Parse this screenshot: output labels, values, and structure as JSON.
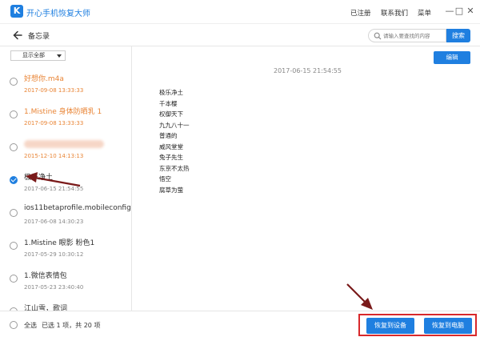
{
  "app": {
    "title": "开心手机恢复大师",
    "logo_letter": "K",
    "top_links": [
      "已注册",
      "联系我们",
      "菜单"
    ],
    "window_controls": [
      "—",
      "□",
      "✕"
    ]
  },
  "header": {
    "back_title": "备忘录",
    "search_placeholder": "请输入要查找的内容",
    "search_button": "搜索"
  },
  "sidebar": {
    "filter_label": "显示全部",
    "items": [
      {
        "title": "好想你.m4a",
        "date": "2017-09-08 13:33:33",
        "style": "orange",
        "checked": false,
        "blurred": false
      },
      {
        "title": "1.Mistine 身体防晒乳 1",
        "date": "2017-09-08 13:33:33",
        "style": "orange",
        "checked": false,
        "blurred": false
      },
      {
        "title": "",
        "date": "2015-12-10 14:13:13",
        "style": "orange",
        "checked": false,
        "blurred": true
      },
      {
        "title": "极乐净土",
        "date": "2017-06-15 21:54:55",
        "style": "normal",
        "checked": true,
        "blurred": false
      },
      {
        "title": "ios11betaprofile.mobileconfig",
        "date": "2017-06-08 14:30:23",
        "style": "normal",
        "checked": false,
        "blurred": false
      },
      {
        "title": "1.Mistine 眼影 粉色1",
        "date": "2017-05-29 10:30:12",
        "style": "normal",
        "checked": false,
        "blurred": false
      },
      {
        "title": "1.微信表情包",
        "date": "2017-05-23 23:40:40",
        "style": "normal",
        "checked": false,
        "blurred": false
      },
      {
        "title": "江山雪，歌词",
        "date": "",
        "style": "normal",
        "checked": false,
        "blurred": false
      }
    ]
  },
  "content": {
    "edit_button": "编辑",
    "note_date": "2017-06-15 21:54:55",
    "note_lines": [
      "极乐净土",
      "千本樱",
      "权御天下",
      "九九八十一",
      "普通的",
      "威风堂堂",
      "兔子先生",
      "东京不太热",
      "悟空",
      "腐草为萤"
    ]
  },
  "footer": {
    "select_all": "全选",
    "status": "已选 1 项，共 20 项",
    "restore_device": "恢复到设备",
    "restore_pc": "恢复到电脑"
  },
  "colors": {
    "accent": "#1f7fe0",
    "orange": "#e98536",
    "highlight_red": "#d8282b",
    "arrow": "#7a1a1a"
  }
}
